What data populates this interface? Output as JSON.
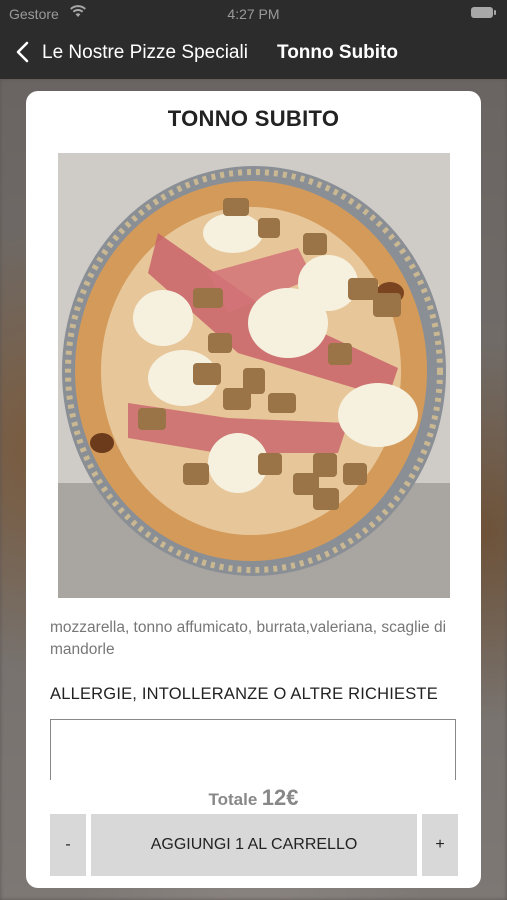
{
  "status": {
    "carrier": "Gestore",
    "time": "4:27 PM"
  },
  "nav": {
    "back_label": "Le Nostre Pizze Speciali",
    "title": "Tonno Subito"
  },
  "product": {
    "title": "TONNO SUBITO",
    "description": "mozzarella, tonno affumicato, burrata,valeriana, scaglie di mandorle",
    "requests_label": "ALLERGIE, INTOLLERANZE O ALTRE RICHIESTE",
    "requests_value": "",
    "total_label": "Totale",
    "total_value": "12€"
  },
  "actions": {
    "minus": "-",
    "add": "AGGIUNGI 1 AL CARRELLO",
    "plus": "+"
  },
  "icons": [
    "wifi-icon",
    "battery-icon",
    "back-chevron-icon"
  ],
  "colors": {
    "bar": "#2c2c2c",
    "button": "#d8d8d8",
    "card": "#ffffff"
  }
}
